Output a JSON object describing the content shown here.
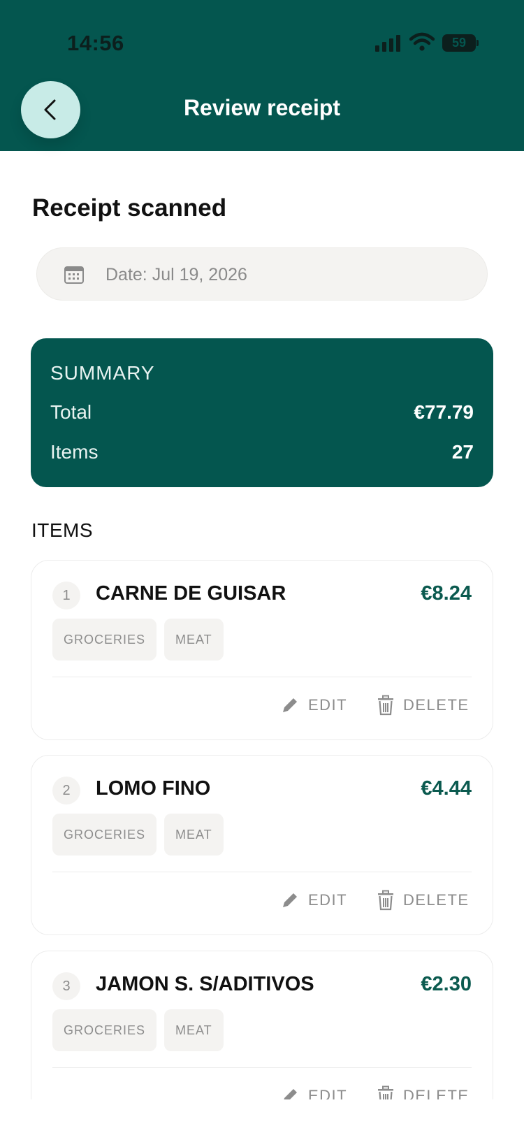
{
  "status_bar": {
    "time": "14:56",
    "battery": "59"
  },
  "header": {
    "title": "Review receipt"
  },
  "page": {
    "heading": "Receipt scanned",
    "date_label": "Date: Jul 19, 2026"
  },
  "summary": {
    "heading": "SUMMARY",
    "total_label": "Total",
    "total_value": "€77.79",
    "items_label": "Items",
    "items_value": "27"
  },
  "items_heading": "ITEMS",
  "item_actions": {
    "edit": "EDIT",
    "delete": "DELETE"
  },
  "items": [
    {
      "index": "1",
      "name": "CARNE DE GUISAR",
      "price": "€8.24",
      "tags": [
        "GROCERIES",
        "MEAT"
      ]
    },
    {
      "index": "2",
      "name": "LOMO FINO",
      "price": "€4.44",
      "tags": [
        "GROCERIES",
        "MEAT"
      ]
    },
    {
      "index": "3",
      "name": "JAMON S. S/ADITIVOS",
      "price": "€2.30",
      "tags": [
        "GROCERIES",
        "MEAT"
      ]
    }
  ],
  "colors": {
    "brand": "#04564f",
    "accent_text": "#0b5a4f",
    "back_button": "#c8ebe7"
  },
  "icons": [
    "chevron-left-icon",
    "calendar-icon",
    "pencil-icon",
    "trash-icon",
    "signal-icon",
    "wifi-icon",
    "battery-icon"
  ]
}
